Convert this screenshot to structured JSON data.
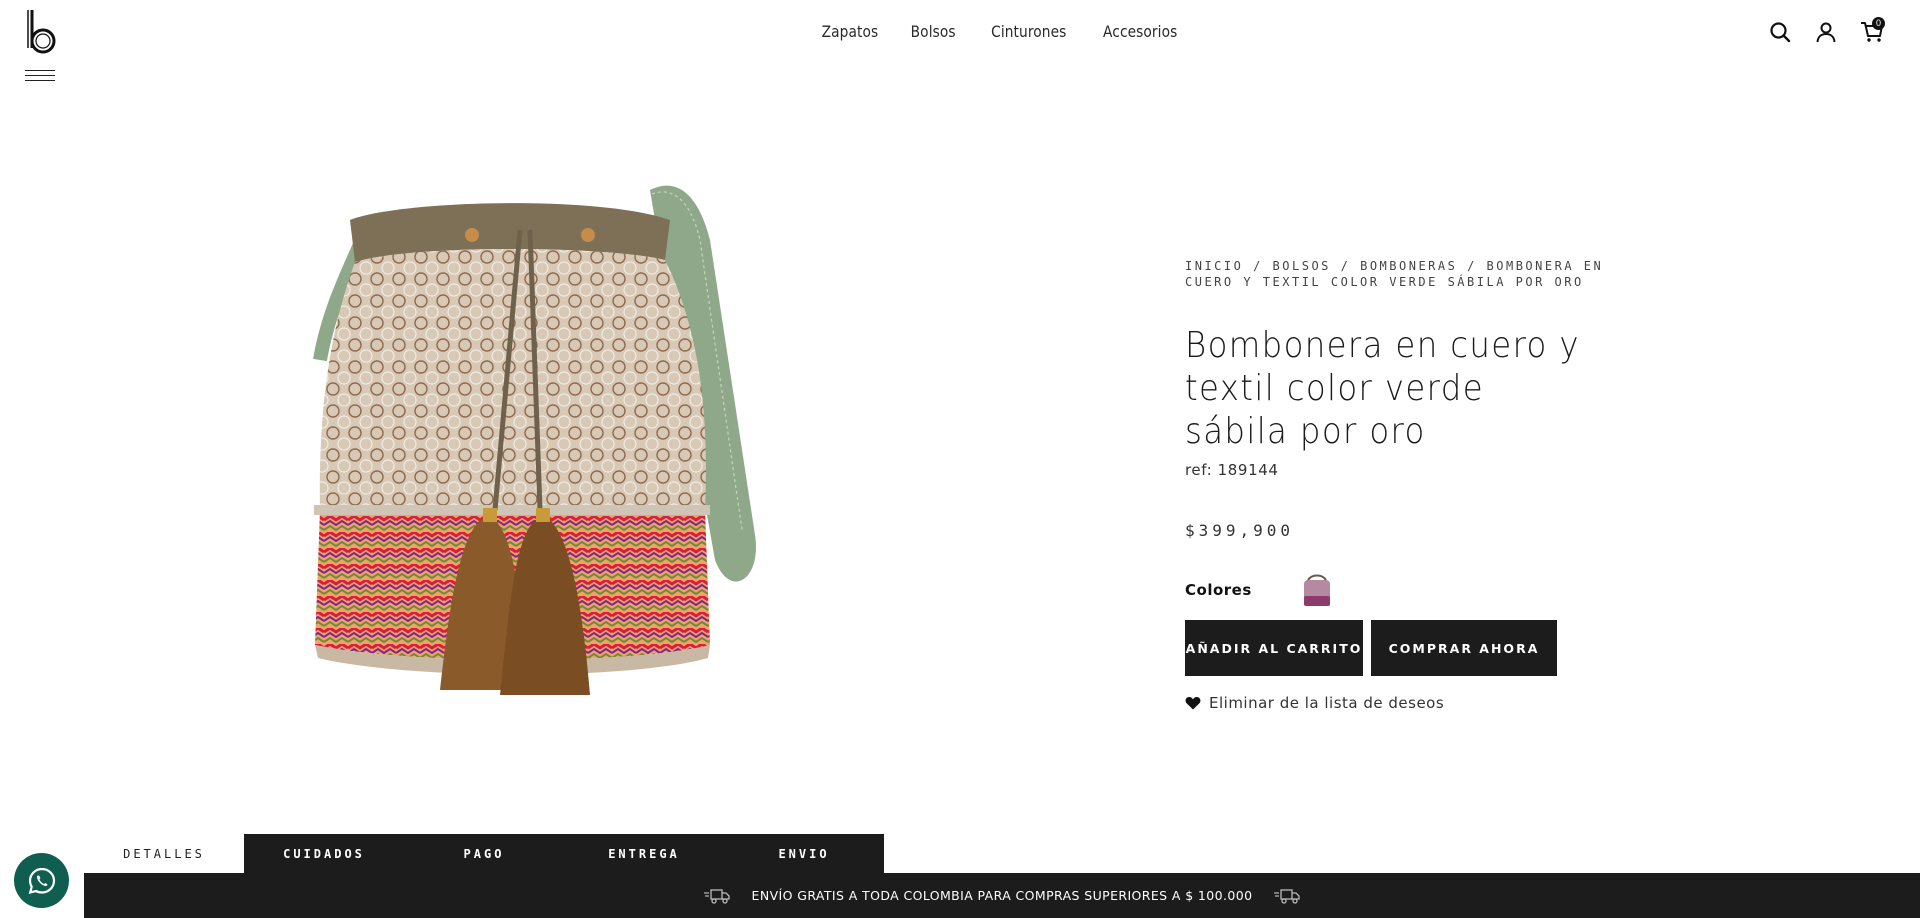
{
  "header": {
    "logo_icon": "brand-b-logo",
    "menu_icon": "hamburger-menu-icon",
    "nav": [
      {
        "label": "Zapatos"
      },
      {
        "label": "Bolsos"
      },
      {
        "label": "Cinturones"
      },
      {
        "label": "Accesorios"
      }
    ],
    "icons": [
      "search-icon",
      "user-icon",
      "cart-icon"
    ],
    "cart_count": "0"
  },
  "product": {
    "breadcrumb": [
      {
        "label": "INICIO"
      },
      {
        "label": "BOLSOS"
      },
      {
        "label": "BOMBONERAS"
      },
      {
        "label": "BOMBONERA EN CUERO Y TEXTIL COLOR VERDE SÁBILA POR ORO"
      }
    ],
    "breadcrumb_separator": " / ",
    "title": "Bombonera en cuero y textil color verde sábila por oro",
    "ref": "ref: 189144",
    "price": "$399,900",
    "colors_label": "Colores",
    "add_to_cart": "AÑADIR AL CARRITO",
    "buy_now": "COMPRAR AHORA",
    "wishlist_label": "Eliminar de la lista de deseos",
    "wishlist_icon": "heart-icon"
  },
  "tabs": [
    {
      "label": "DETALLES",
      "active": true
    },
    {
      "label": "CUIDADOS",
      "active": false
    },
    {
      "label": "PAGO",
      "active": false
    },
    {
      "label": "ENTREGA",
      "active": false
    },
    {
      "label": "ENVIO",
      "active": false
    }
  ],
  "banner": {
    "text": "ENVÍO GRATIS A TODA COLOMBIA PARA COMPRAS SUPERIORES A $ 100.000",
    "icon": "delivery-truck-icon"
  },
  "whatsapp_icon": "whatsapp-icon",
  "colors": {
    "dark": "#1c1c1c",
    "whatsapp": "#0f5e4f",
    "strap_green": "#8fa88a"
  }
}
